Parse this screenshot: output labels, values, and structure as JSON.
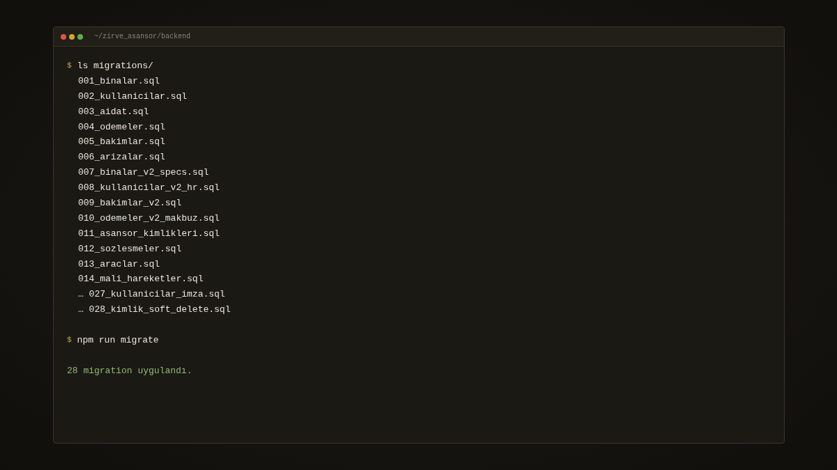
{
  "window": {
    "title": "~/zirve_asansor/backend"
  },
  "lines": [
    {
      "kind": "command",
      "prompt": "$",
      "text": "ls migrations/"
    },
    {
      "kind": "output",
      "text": "001_binalar.sql"
    },
    {
      "kind": "output",
      "text": "002_kullanicilar.sql"
    },
    {
      "kind": "output",
      "text": "003_aidat.sql"
    },
    {
      "kind": "output",
      "text": "004_odemeler.sql"
    },
    {
      "kind": "output",
      "text": "005_bakimlar.sql"
    },
    {
      "kind": "output",
      "text": "006_arizalar.sql"
    },
    {
      "kind": "output",
      "text": "007_binalar_v2_specs.sql"
    },
    {
      "kind": "output",
      "text": "008_kullanicilar_v2_hr.sql"
    },
    {
      "kind": "output",
      "text": "009_bakimlar_v2.sql"
    },
    {
      "kind": "output",
      "text": "010_odemeler_v2_makbuz.sql"
    },
    {
      "kind": "output",
      "text": "011_asansor_kimlikleri.sql"
    },
    {
      "kind": "output",
      "text": "012_sozlesmeler.sql"
    },
    {
      "kind": "output",
      "text": "013_araclar.sql"
    },
    {
      "kind": "output",
      "text": "014_mali_hareketler.sql"
    },
    {
      "kind": "output",
      "text": "… 027_kullanicilar_imza.sql"
    },
    {
      "kind": "output",
      "text": "… 028_kimlik_soft_delete.sql"
    },
    {
      "kind": "blank"
    },
    {
      "kind": "command",
      "prompt": "$",
      "text": "npm run migrate"
    },
    {
      "kind": "blank"
    },
    {
      "kind": "success",
      "text": "28 migration uygulandı."
    }
  ]
}
